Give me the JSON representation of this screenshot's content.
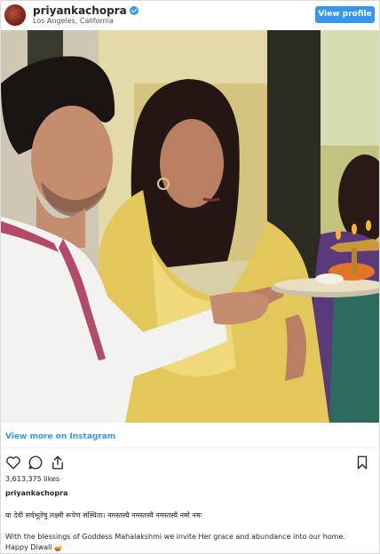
{
  "header": {
    "username": "priyankachopra",
    "location": "Los Angeles, California",
    "view_profile_label": "View profile"
  },
  "carousel": {
    "dot_count": 5,
    "active_index": 0
  },
  "footer": {
    "view_more": "View more on Instagram",
    "likes": "3,613,375 likes",
    "caption_username": "priyankachopra",
    "caption_mantra": "या देवी सर्वभूतेषु लक्ष्मी रूपेण संस्थिता। नमस्तस्यै नमस्तस्यै नमस्तस्यै नमो नमः",
    "caption_line1": "With the blessings of Goddess Mahalakshmi we invite Her grace and abundance into our home.",
    "caption_line2": "Happy Diwali 🪔"
  },
  "icons": [
    "heart-icon",
    "comment-icon",
    "share-icon",
    "bookmark-icon",
    "verified-badge-icon"
  ],
  "colors": {
    "accent": "#3797f0",
    "link": "#3897f0",
    "text": "#262626"
  }
}
